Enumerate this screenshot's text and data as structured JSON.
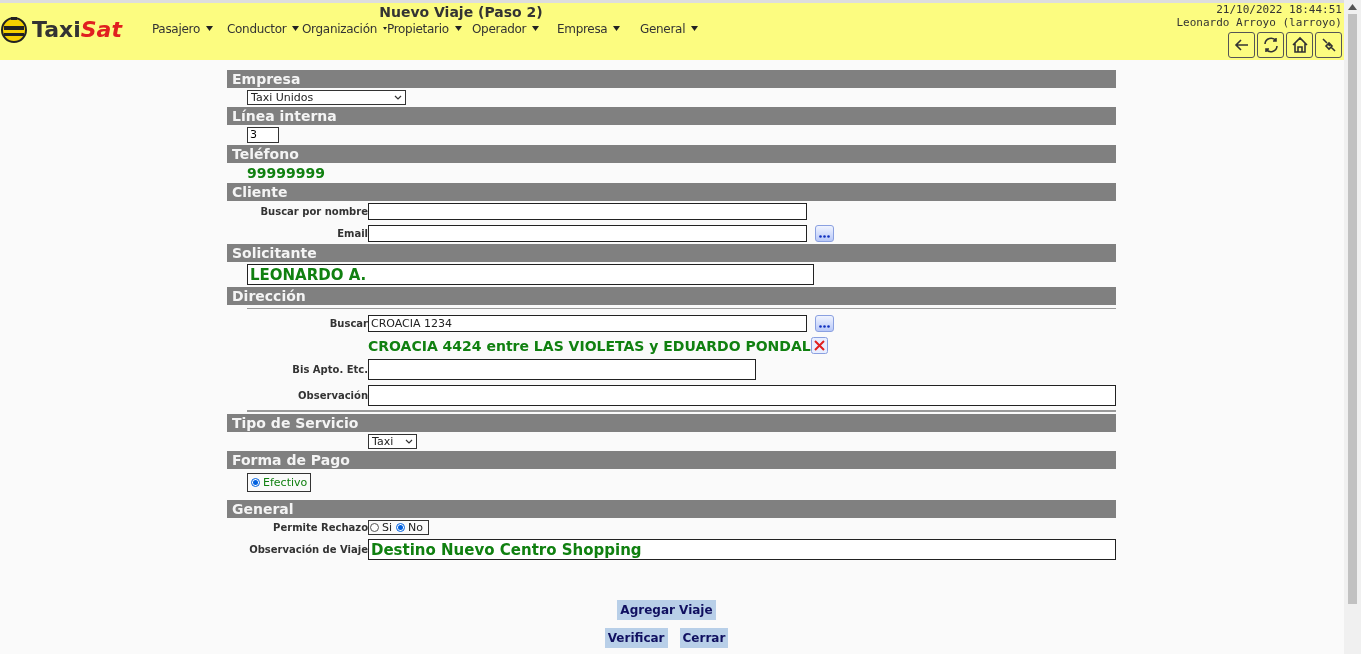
{
  "header": {
    "logo": {
      "plain": "Taxi",
      "accent": "Sat"
    },
    "title": "Nuevo Viaje (Paso 2)",
    "menu": [
      {
        "label": "Pasajero"
      },
      {
        "label": "Conductor"
      },
      {
        "label": "Organización"
      },
      {
        "label": "Propietario"
      },
      {
        "label": "Operador"
      },
      {
        "label": "Empresa"
      },
      {
        "label": "General"
      }
    ],
    "datetime": "21/10/2022 18:44:51",
    "user": "Leonardo Arroyo (larroyo)",
    "tools": [
      {
        "kind": "back"
      },
      {
        "kind": "refresh"
      },
      {
        "kind": "home"
      },
      {
        "kind": "disconnect"
      }
    ]
  },
  "sections": [
    {
      "title": "Empresa",
      "kind": "select",
      "value": "Taxi Unidos"
    },
    {
      "title": "Línea interna",
      "kind": "short_input",
      "value": "3"
    },
    {
      "title": "Teléfono",
      "kind": "phone",
      "value": "99999999"
    },
    {
      "title": "Cliente",
      "kind": "client",
      "fields": [
        {
          "label": "Buscar por nombre"
        },
        {
          "label": "Email"
        }
      ]
    },
    {
      "title": "Solicitante",
      "kind": "big_input",
      "value": "LEONARDO A."
    },
    {
      "title": "Dirección",
      "kind": "address",
      "search_label": "Buscar",
      "search_value": "CROACIA 1234",
      "resolved": "CROACIA 4424 entre LAS VIOLETAS y EDUARDO PONDAL",
      "fields": [
        {
          "label": "Bis Apto. Etc."
        },
        {
          "label": "Observación"
        }
      ]
    },
    {
      "title": "Tipo de Servicio",
      "kind": "small_select",
      "value": "Taxi"
    },
    {
      "title": "Forma de Pago",
      "kind": "radio",
      "options": [
        {
          "label": "Efectivo",
          "selected": true
        }
      ]
    },
    {
      "title": "General",
      "kind": "general",
      "reject_label": "Permite Rechazo",
      "options": [
        {
          "label": "Si",
          "selected": false
        },
        {
          "label": "No",
          "selected": true
        }
      ],
      "obs_label": "Observación de Viaje",
      "obs_value": "Destino Nuevo Centro Shopping"
    }
  ],
  "buttons": [
    [
      "Agregar Viaje"
    ],
    [
      "Verificar",
      "Cerrar"
    ]
  ]
}
